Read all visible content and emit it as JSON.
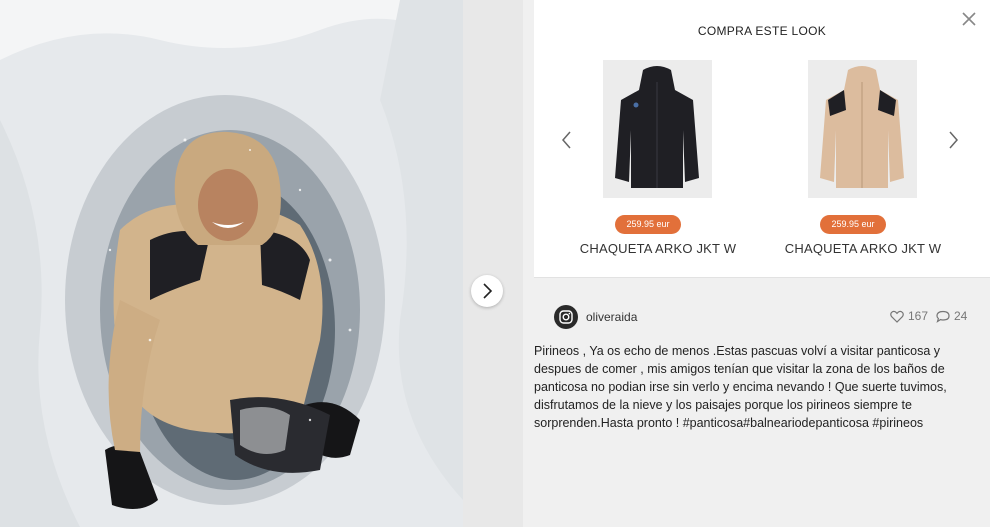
{
  "look": {
    "title": "COMPRA ESTE LOOK",
    "products": [
      {
        "name": "CHAQUETA ARKO JKT W",
        "price": "259.95 eur",
        "color": "#1f1f24"
      },
      {
        "name": "CHAQUETA ARKO JKT W",
        "price": "259.95 eur",
        "color": "#d9b899"
      }
    ]
  },
  "post": {
    "username": "oliveraida",
    "likes": "167",
    "comments": "24",
    "caption": "Pirineos , Ya os echo de menos .Estas pascuas volví a visitar panticosa y despues de comer , mis amigos tenían que visitar la zona de los baños de panticosa no podian irse sin verlo y encima nevando ! Que suerte tuvimos, disfrutamos de la nieve y los paisajes porque los pirineos siempre te sorprenden.Hasta pronto ! #panticosa#balneariodepanticosa #pirineos"
  },
  "colors": {
    "price_badge": "#e2703a",
    "jacket_beige": "#d2b48c",
    "jacket_black": "#1f1f24"
  },
  "icons": [
    "chevron-right-icon",
    "close-icon",
    "chevron-left-icon",
    "instagram-icon",
    "heart-icon",
    "comment-icon"
  ]
}
